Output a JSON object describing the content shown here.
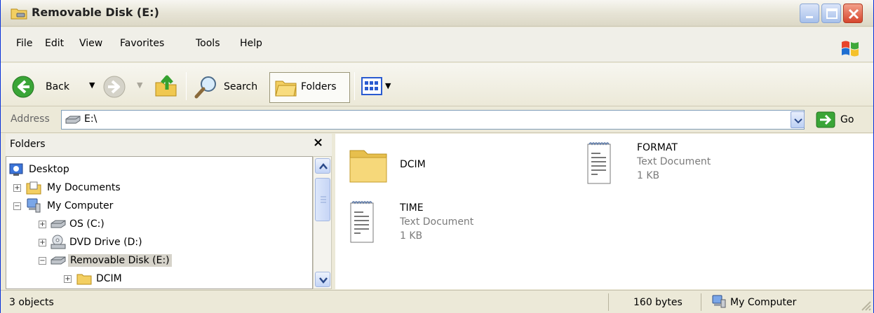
{
  "window": {
    "title": "Removable Disk (E:)"
  },
  "menu": [
    "File",
    "Edit",
    "View",
    "Favorites",
    "Tools",
    "Help"
  ],
  "toolbar": {
    "back_label": "Back",
    "search_label": "Search",
    "folders_label": "Folders"
  },
  "address": {
    "label": "Address",
    "value": "E:\\",
    "go_label": "Go"
  },
  "folders_pane": {
    "title": "Folders",
    "close_symbol": "×",
    "tree": [
      {
        "label": "Desktop",
        "expander": ""
      },
      {
        "label": "My Documents",
        "expander": "+"
      },
      {
        "label": "My Computer",
        "expander": "−"
      },
      {
        "label": "OS (C:)",
        "expander": "+"
      },
      {
        "label": "DVD Drive (D:)",
        "expander": "+"
      },
      {
        "label": "Removable Disk (E:)",
        "expander": "−",
        "selected": true
      },
      {
        "label": "DCIM",
        "expander": "+"
      }
    ]
  },
  "files": [
    {
      "name": "DCIM",
      "icon": "folder-icon"
    },
    {
      "name": "FORMAT",
      "type": "Text Document",
      "size": "1 KB",
      "icon": "text-document-icon"
    },
    {
      "name": "TIME",
      "type": "Text Document",
      "size": "1 KB",
      "icon": "text-document-icon"
    }
  ],
  "status": {
    "objects": "3 objects",
    "size": "160 bytes",
    "location": "My Computer"
  },
  "colors": {
    "accent": "#0831d9",
    "folder": "#f5d77a",
    "back_green": "#3aa537"
  }
}
